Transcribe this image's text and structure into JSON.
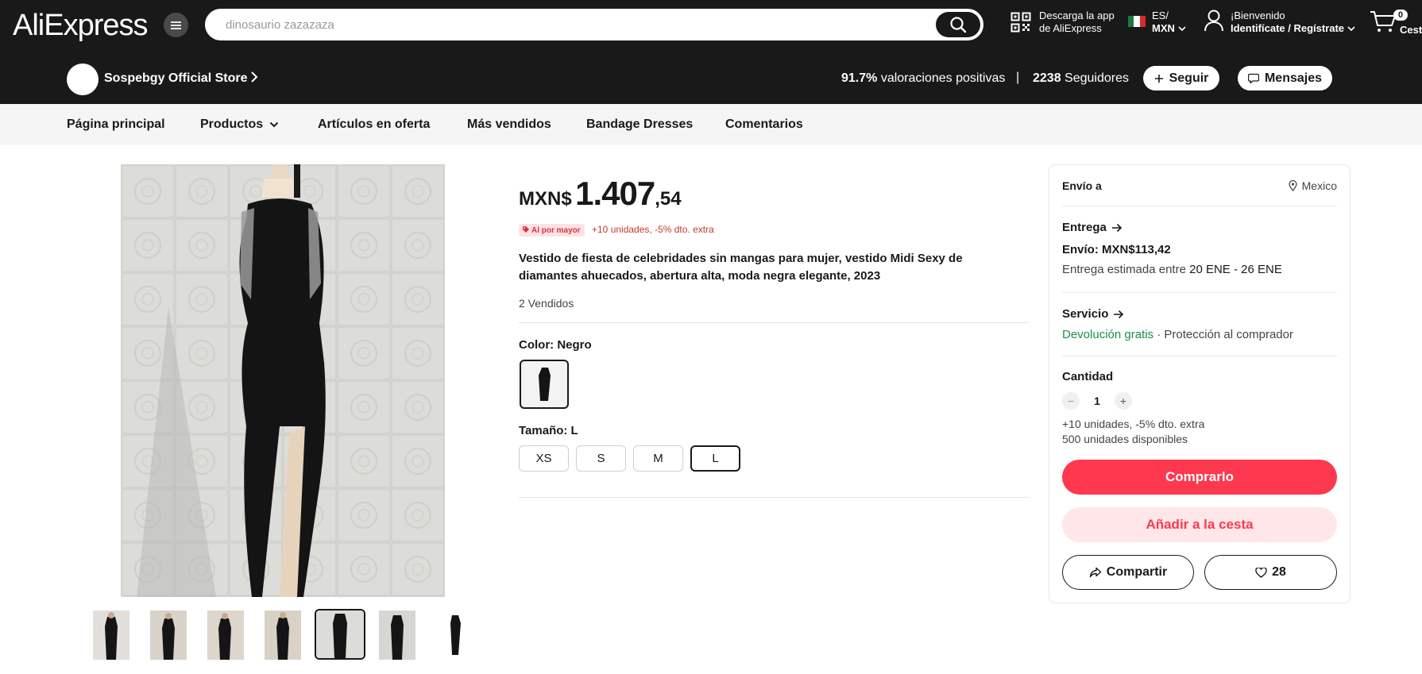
{
  "header": {
    "logo": "AliExpress",
    "search_placeholder": "dinosaurio zazazaza",
    "app_line1": "Descarga la app",
    "app_line2": "de AliExpress",
    "lang": "ES/",
    "currency": "MXN",
    "greeting": "¡Bienvenido",
    "signin": "Identifícate / Regístrate",
    "cart_count": "0",
    "cart_label": "Cesta"
  },
  "store": {
    "name": "Sospebgy Official Store",
    "rating_value": "91.7%",
    "rating_label": "valoraciones positivas",
    "separator": "|",
    "followers_value": "2238",
    "followers_label": "Seguidores",
    "follow_label": "Seguir",
    "messages_label": "Mensajes"
  },
  "nav": {
    "items": [
      "Página principal",
      "Productos",
      "Artículos en oferta",
      "Más vendidos",
      "Bandage Dresses",
      "Comentarios"
    ]
  },
  "product": {
    "price_currency": "MXN$",
    "price_integer": "1.407",
    "price_decimal": ",54",
    "bulk_badge": "Al por mayor",
    "bulk_text": "+10 unidades, -5% dto. extra",
    "title": "Vestido de fiesta de celebridades sin mangas para mujer, vestido Midi Sexy de diamantes ahuecados, abertura alta, moda negra elegante, 2023",
    "sold": "2 Vendidos",
    "color_label": "Color: Negro",
    "size_label": "Tamaño: L",
    "sizes": [
      "XS",
      "S",
      "M",
      "L"
    ],
    "selected_size": "L"
  },
  "panel": {
    "ship_to": "Envío a",
    "country": "Mexico",
    "delivery_title": "Entrega",
    "shipping_cost": "Envío: MXN$113,42",
    "eta_prefix": "Entrega estimada entre",
    "eta_range": "20 ENE - 26 ENE",
    "service_title": "Servicio",
    "free_return": "Devolución gratis",
    "protection": "· Protección al comprador",
    "quantity_title": "Cantidad",
    "quantity": "1",
    "qty_minus": "−",
    "qty_plus": "+",
    "bulk_note": "+10 unidades, -5% dto. extra",
    "stock": "500 unidades disponibles",
    "buy_label": "Comprarlo",
    "add_cart_label": "Añadir a la cesta",
    "share_label": "Compartir",
    "wishlist_count": "28"
  },
  "colors": {
    "header_bg": "#191919",
    "accent": "#fd384f",
    "accent_light": "#ffe7e9",
    "green": "#1b8f47",
    "nav_bg": "#f5f5f5"
  },
  "icons": [
    "menu-icon",
    "search-icon",
    "qr-code-icon",
    "mexico-flag-icon",
    "user-icon",
    "cart-icon",
    "chevron-right-icon",
    "plus-icon",
    "message-icon",
    "chevron-down-icon",
    "location-pin-icon",
    "arrow-right-icon",
    "share-icon",
    "heart-icon"
  ]
}
